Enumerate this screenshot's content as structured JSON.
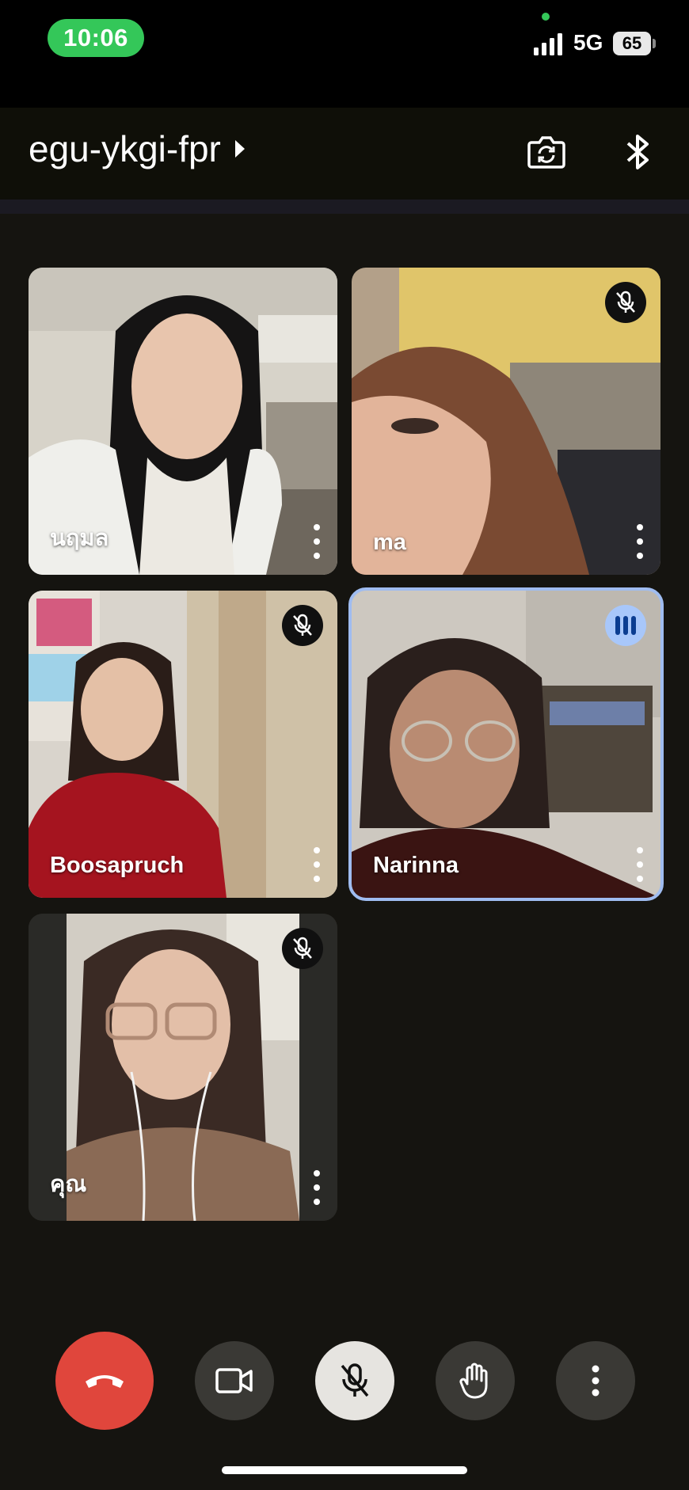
{
  "status_bar": {
    "time": "10:06",
    "network": "5G",
    "battery": "65"
  },
  "header": {
    "meeting_code": "egu-ykgi-fpr",
    "icons": [
      "switch-camera-icon",
      "bluetooth-icon"
    ]
  },
  "participants": [
    {
      "name": "นฤมล",
      "muted": false,
      "speaking": false
    },
    {
      "name": "ma",
      "muted": true,
      "speaking": false
    },
    {
      "name": "Boosapruch",
      "muted": true,
      "speaking": false
    },
    {
      "name": "Narinna",
      "muted": false,
      "speaking": true
    },
    {
      "name": "คุณ",
      "muted": true,
      "speaking": false
    }
  ],
  "controls": [
    "end-call",
    "camera",
    "microphone-muted",
    "raise-hand",
    "more-options"
  ],
  "colors": {
    "background": "#151410",
    "end_call": "#e0463c",
    "speaking_outline": "#9fbcf0",
    "status_pill": "#34c759"
  }
}
